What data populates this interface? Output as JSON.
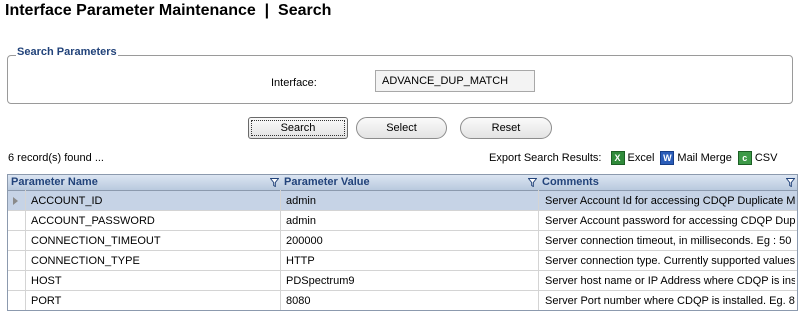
{
  "page": {
    "title": "Interface Parameter Maintenance  |  Search"
  },
  "search_panel": {
    "legend": "Search Parameters",
    "interface_label": "Interface:",
    "interface_value": "ADVANCE_DUP_MATCH"
  },
  "buttons": {
    "search": "Search",
    "select": "Select",
    "reset": "Reset"
  },
  "results": {
    "count_text": "6 record(s) found ...",
    "export_label": "Export Search Results:",
    "export_excel": "Excel",
    "export_mail_merge": "Mail Merge",
    "export_csv": "CSV",
    "icons": [
      "excel-icon",
      "word-icon",
      "csv-icon",
      "filter-icon"
    ]
  },
  "table": {
    "columns": [
      "Parameter Name",
      "Parameter Value",
      "Comments"
    ],
    "rows": [
      [
        "ACCOUNT_ID",
        "admin",
        "Server Account Id for accessing CDQP Duplicate M"
      ],
      [
        "ACCOUNT_PASSWORD",
        "admin",
        "Server Account password for accessing CDQP Dupli"
      ],
      [
        "CONNECTION_TIMEOUT",
        "200000",
        "Server connection timeout, in milliseconds. Eg : 50"
      ],
      [
        "CONNECTION_TYPE",
        "HTTP",
        "Server connection type. Currently supported values"
      ],
      [
        "HOST",
        "PDSpectrum9",
        "Server host name or IP Address where CDQP is ins"
      ],
      [
        "PORT",
        "8080",
        "Server Port number where CDQP is installed. Eg. 8"
      ]
    ],
    "selected_row": 0
  },
  "colors": {
    "header_text": "#22437a",
    "selected_row": "#c6d3e6",
    "header_bg": "#c9d7e8"
  }
}
